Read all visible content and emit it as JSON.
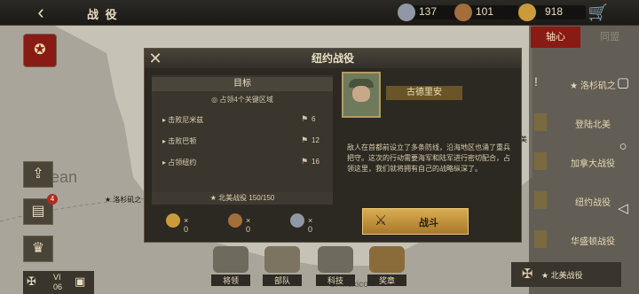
{
  "topbar": {
    "title": "战 役",
    "resources": [
      {
        "icon": "medal-silver-icon",
        "value": "137"
      },
      {
        "icon": "medal-bronze-icon",
        "value": "101"
      },
      {
        "icon": "star-badge-icon",
        "value": "918"
      }
    ]
  },
  "side": {
    "tabs": [
      "轴心",
      "同盟"
    ],
    "items": [
      "★ 洛杉矶之",
      "登陆北美",
      "加拿大战役",
      "纽约战役",
      "华盛顿战役"
    ]
  },
  "map": {
    "labels": [
      "Ocean",
      "★ 洛杉矶之",
      "登陆北美",
      "of Mexico"
    ]
  },
  "left": {
    "badge": "4",
    "rank": "VI",
    "rank_num": "06"
  },
  "dialog": {
    "title": "纽约战役",
    "objectives": {
      "header": "目标",
      "sub": "占领4个关键区域",
      "rows": [
        {
          "label": "击败尼米兹",
          "value": "6"
        },
        {
          "label": "击败巴顿",
          "value": "12"
        },
        {
          "label": "占领纽约",
          "value": "16"
        }
      ],
      "progress": "★ 北美战役   150/150"
    },
    "rewards": [
      {
        "icon": "star-medal-icon",
        "value": "× 0"
      },
      {
        "icon": "bronze-medal-icon",
        "value": "× 0"
      },
      {
        "icon": "silver-medal-icon",
        "value": "× 0"
      }
    ],
    "general": "古德里安",
    "description": "敌人在首都前设立了多条防线，沿海地区也涌了重兵把守。这次的行动需要海军和陆军进行密切配合，占领这里，我们就将拥有自己的战略纵深了。",
    "fight": "战斗"
  },
  "bottom_nav": [
    "将领",
    "部队",
    "科技",
    "奖章"
  ],
  "bottombar": {
    "label": "★ 北美战役"
  }
}
